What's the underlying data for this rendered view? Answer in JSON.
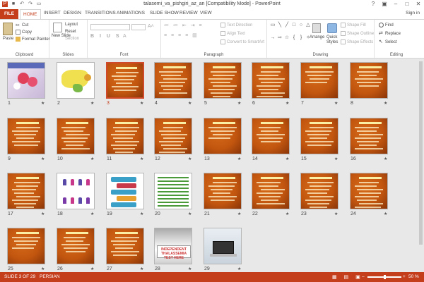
{
  "window": {
    "title": "talasemi_va_pishgiri_az_an [Compatibility Mode] - PowerPoint",
    "signin": "Sign in"
  },
  "tabs": [
    "FILE",
    "HOME",
    "INSERT",
    "DESIGN",
    "TRANSITIONS",
    "ANIMATIONS",
    "SLIDE SHOW",
    "REVIEW",
    "VIEW"
  ],
  "active_tab": "HOME",
  "ribbon": {
    "clipboard": {
      "label": "Clipboard",
      "paste": "Paste",
      "cut": "Cut",
      "copy": "Copy",
      "format_painter": "Format Painter"
    },
    "slides": {
      "label": "Slides",
      "new_slide": "New Slide",
      "layout": "Layout",
      "reset": "Reset",
      "section": "Section"
    },
    "font": {
      "label": "Font",
      "font_name": "",
      "font_size": ""
    },
    "paragraph": {
      "label": "Paragraph",
      "text_direction": "Text Direction",
      "align_text": "Align Text",
      "convert": "Convert to SmartArt"
    },
    "drawing": {
      "label": "Drawing",
      "arrange": "Arrange",
      "quick_styles": "Quick Styles",
      "shape_fill": "Shape Fill",
      "shape_outline": "Shape Outline",
      "shape_effects": "Shape Effects"
    },
    "editing": {
      "label": "Editing",
      "find": "Find",
      "replace": "Replace",
      "select": "Select"
    }
  },
  "slides": [
    {
      "n": "1",
      "kind": "pic-medical"
    },
    {
      "n": "2",
      "kind": "pic-map"
    },
    {
      "n": "3",
      "kind": "orange",
      "selected": true
    },
    {
      "n": "4",
      "kind": "orange"
    },
    {
      "n": "5",
      "kind": "orange"
    },
    {
      "n": "6",
      "kind": "orange"
    },
    {
      "n": "7",
      "kind": "orange"
    },
    {
      "n": "8",
      "kind": "orange"
    },
    {
      "n": "9",
      "kind": "orange"
    },
    {
      "n": "10",
      "kind": "orange"
    },
    {
      "n": "11",
      "kind": "orange"
    },
    {
      "n": "12",
      "kind": "orange"
    },
    {
      "n": "13",
      "kind": "orange"
    },
    {
      "n": "14",
      "kind": "orange"
    },
    {
      "n": "15",
      "kind": "orange"
    },
    {
      "n": "16",
      "kind": "orange"
    },
    {
      "n": "17",
      "kind": "orange"
    },
    {
      "n": "18",
      "kind": "pic-genetics"
    },
    {
      "n": "19",
      "kind": "pic-diagram"
    },
    {
      "n": "20",
      "kind": "pic-green"
    },
    {
      "n": "21",
      "kind": "orange"
    },
    {
      "n": "22",
      "kind": "orange"
    },
    {
      "n": "23",
      "kind": "orange"
    },
    {
      "n": "24",
      "kind": "orange"
    },
    {
      "n": "25",
      "kind": "orange"
    },
    {
      "n": "26",
      "kind": "orange"
    },
    {
      "n": "27",
      "kind": "orange"
    },
    {
      "n": "28",
      "kind": "photo-sign"
    },
    {
      "n": "29",
      "kind": "photo-laptop"
    }
  ],
  "slide28_sign": "INDEPENDENT THALASSEMIA TEST HERE",
  "status": {
    "slide_of": "SLIDE 3 OF 29",
    "language": "PERSIAN",
    "zoom": "50 %"
  },
  "colors": {
    "accent": "#c43e1c",
    "slide_bg": "#c2560f"
  }
}
